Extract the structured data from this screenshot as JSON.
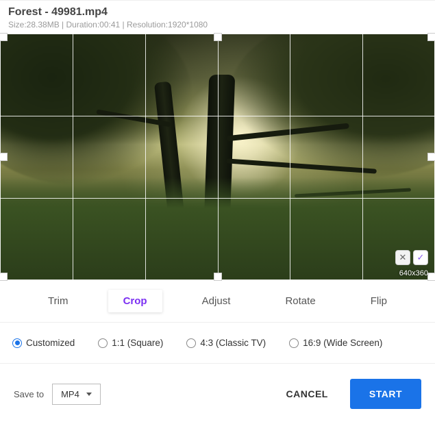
{
  "header": {
    "title": "Forest - 49981.mp4",
    "meta": "Size:28.38MB | Duration:00:41 | Resolution:1920*1080"
  },
  "preview": {
    "crop_dimensions": "640x360",
    "cancel_icon": "✕",
    "confirm_icon": "✓"
  },
  "tabs": [
    {
      "id": "trim",
      "label": "Trim",
      "active": false
    },
    {
      "id": "crop",
      "label": "Crop",
      "active": true
    },
    {
      "id": "adjust",
      "label": "Adjust",
      "active": false
    },
    {
      "id": "rotate",
      "label": "Rotate",
      "active": false
    },
    {
      "id": "flip",
      "label": "Flip",
      "active": false
    }
  ],
  "crop_options": [
    {
      "id": "customized",
      "label": "Customized",
      "selected": true
    },
    {
      "id": "1-1",
      "label": "1:1 (Square)",
      "selected": false
    },
    {
      "id": "4-3",
      "label": "4:3 (Classic TV)",
      "selected": false
    },
    {
      "id": "16-9",
      "label": "16:9 (Wide Screen)",
      "selected": false
    }
  ],
  "footer": {
    "save_to_label": "Save to",
    "format_value": "MP4",
    "cancel_label": "CANCEL",
    "start_label": "START"
  }
}
